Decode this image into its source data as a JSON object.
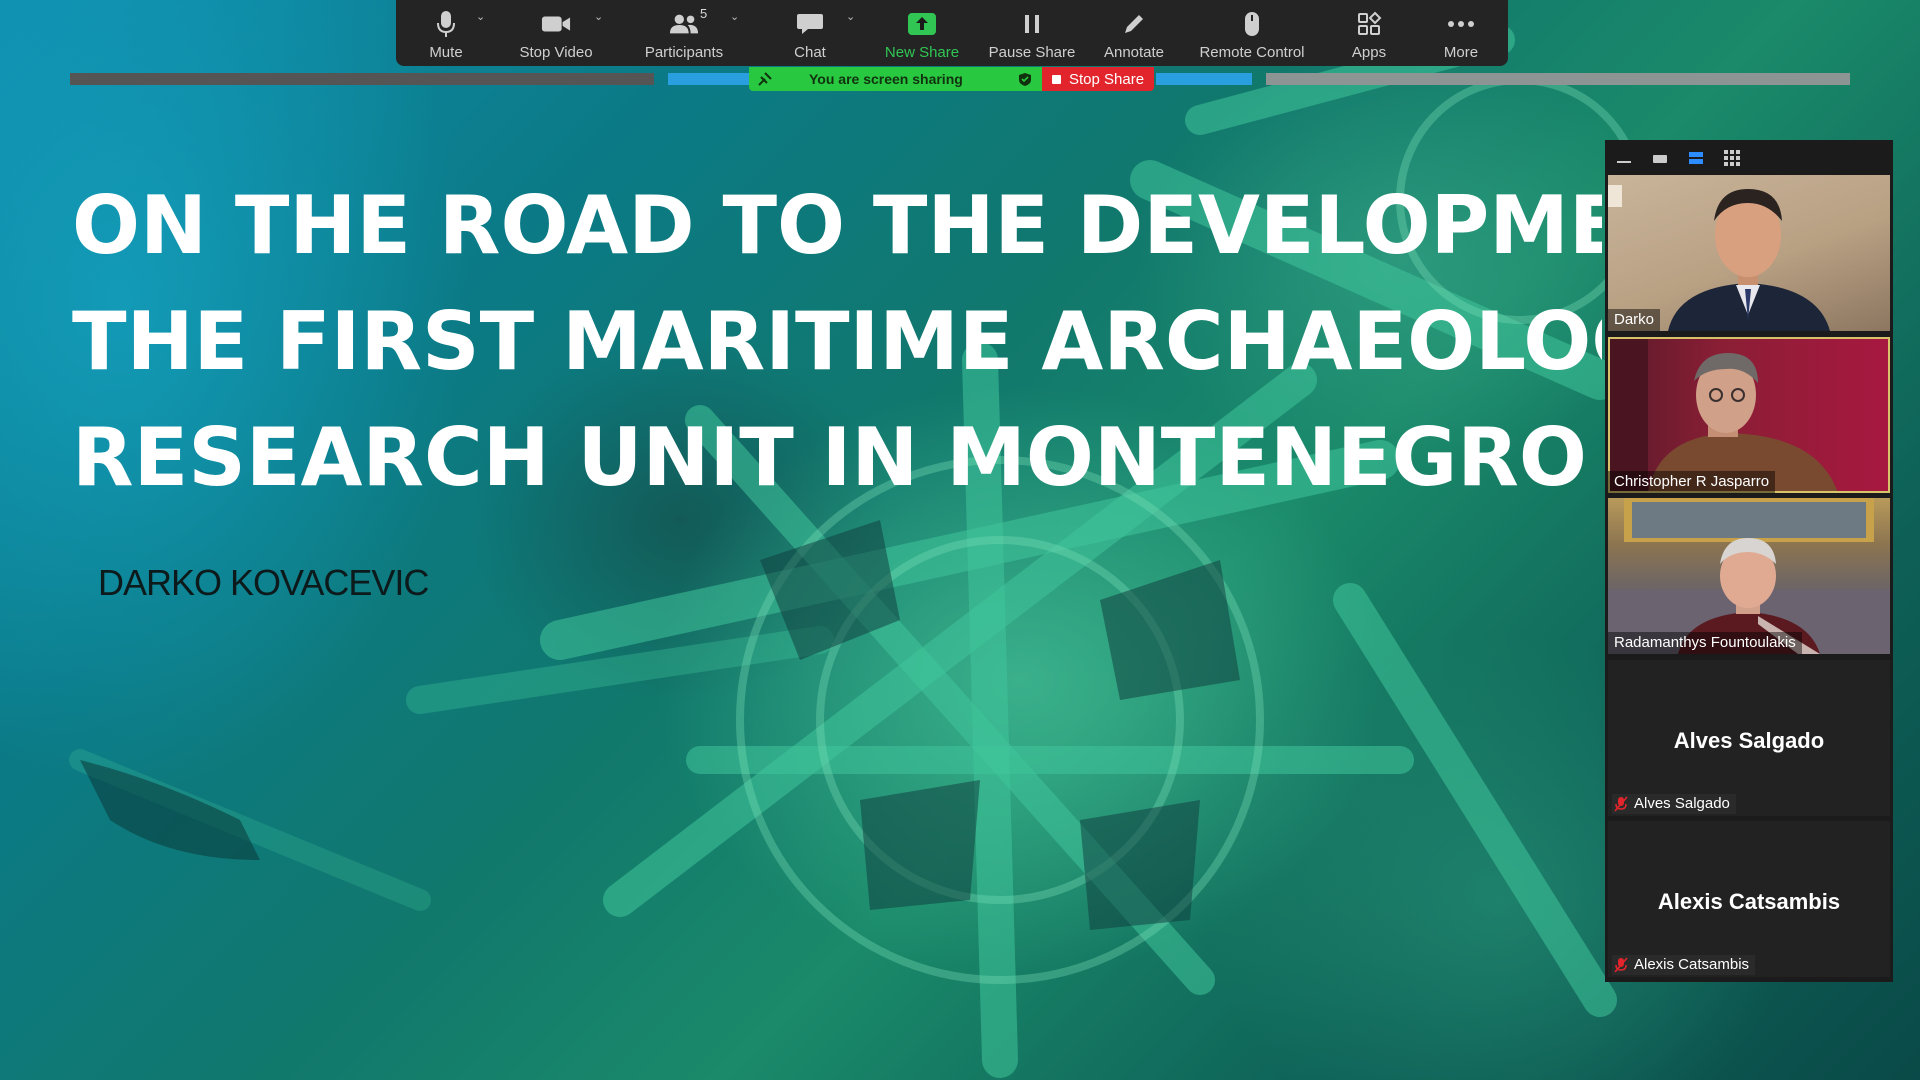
{
  "toolbar": {
    "mute_label": "Mute",
    "stop_video_label": "Stop Video",
    "participants_label": "Participants",
    "participants_count": "5",
    "chat_label": "Chat",
    "new_share_label": "New Share",
    "pause_share_label": "Pause Share",
    "annotate_label": "Annotate",
    "remote_control_label": "Remote Control",
    "apps_label": "Apps",
    "more_label": "More"
  },
  "share_bar": {
    "status": "You are screen sharing",
    "stop_label": "Stop Share"
  },
  "slide": {
    "title_lines": [
      "ON THE ROAD TO THE DEVELOPMENT",
      "THE FIRST MARITIME ARCHAEOLOGY",
      "RESEARCH UNIT IN MONTENEGRO"
    ],
    "author": "DARKO KOVACEVIC"
  },
  "gallery": {
    "participants": [
      {
        "name": "Darko"
      },
      {
        "name": "Christopher R Jasparro"
      },
      {
        "name": "Radamanthys Fountoulakis"
      },
      {
        "name": "Alves Salgado",
        "display_name": "Alves Salgado"
      },
      {
        "name": "Alexis Catsambis",
        "display_name": "Alexis Catsambis"
      }
    ]
  },
  "colors": {
    "toolbar_bg": "#242424",
    "share_green": "#28c840",
    "stop_red": "#e2252c",
    "new_share_green": "#31c654",
    "active_speaker_border": "#d9c36a"
  }
}
